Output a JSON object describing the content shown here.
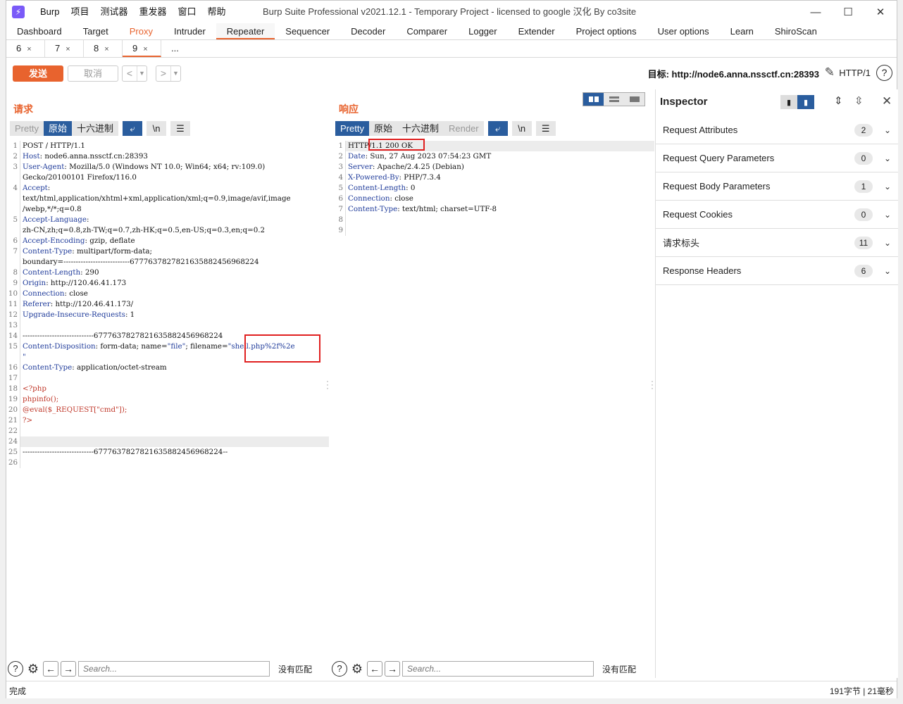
{
  "titlebar": {
    "menu": [
      "Burp",
      "项目",
      "测试器",
      "重发器",
      "窗口",
      "帮助"
    ],
    "title": "Burp Suite Professional v2021.12.1 - Temporary Project - licensed to google 汉化 By co3site",
    "minimize": "—",
    "maximize": "☐",
    "close": "✕"
  },
  "main_tabs": [
    "Dashboard",
    "Target",
    "Proxy",
    "Intruder",
    "Repeater",
    "Sequencer",
    "Decoder",
    "Comparer",
    "Logger",
    "Extender",
    "Project options",
    "User options",
    "Learn",
    "ShiroScan"
  ],
  "sub_tabs": [
    {
      "label": "6",
      "close": "×"
    },
    {
      "label": "7",
      "close": "×"
    },
    {
      "label": "8",
      "close": "×"
    },
    {
      "label": "9",
      "close": "×"
    },
    {
      "label": "...",
      "close": ""
    }
  ],
  "toolbar": {
    "send_label": "发送",
    "cancel_label": "取消",
    "target_label": "目标: http://node6.anna.nssctf.cn:28393",
    "http_version": "HTTP/1",
    "help": "?"
  },
  "request": {
    "title": "请求",
    "tabs": [
      "Pretty",
      "原始",
      "十六进制"
    ],
    "active_tab": "原始"
  },
  "response": {
    "title": "响应",
    "tabs": [
      "Pretty",
      "原始",
      "十六进制",
      "Render"
    ],
    "active_tab": "Pretty"
  },
  "inspector": {
    "title": "Inspector",
    "sections": [
      {
        "label": "Request Attributes",
        "count": "2"
      },
      {
        "label": "Request Query Parameters",
        "count": "0"
      },
      {
        "label": "Request Body Parameters",
        "count": "1"
      },
      {
        "label": "Request Cookies",
        "count": "0"
      },
      {
        "label": "请求标头",
        "count": "11"
      },
      {
        "label": "Response Headers",
        "count": "6"
      }
    ]
  },
  "search": {
    "placeholder": "Search...",
    "no_match": "没有匹配"
  },
  "status": {
    "left": "完成",
    "right": "191字节 | 21毫秒"
  }
}
